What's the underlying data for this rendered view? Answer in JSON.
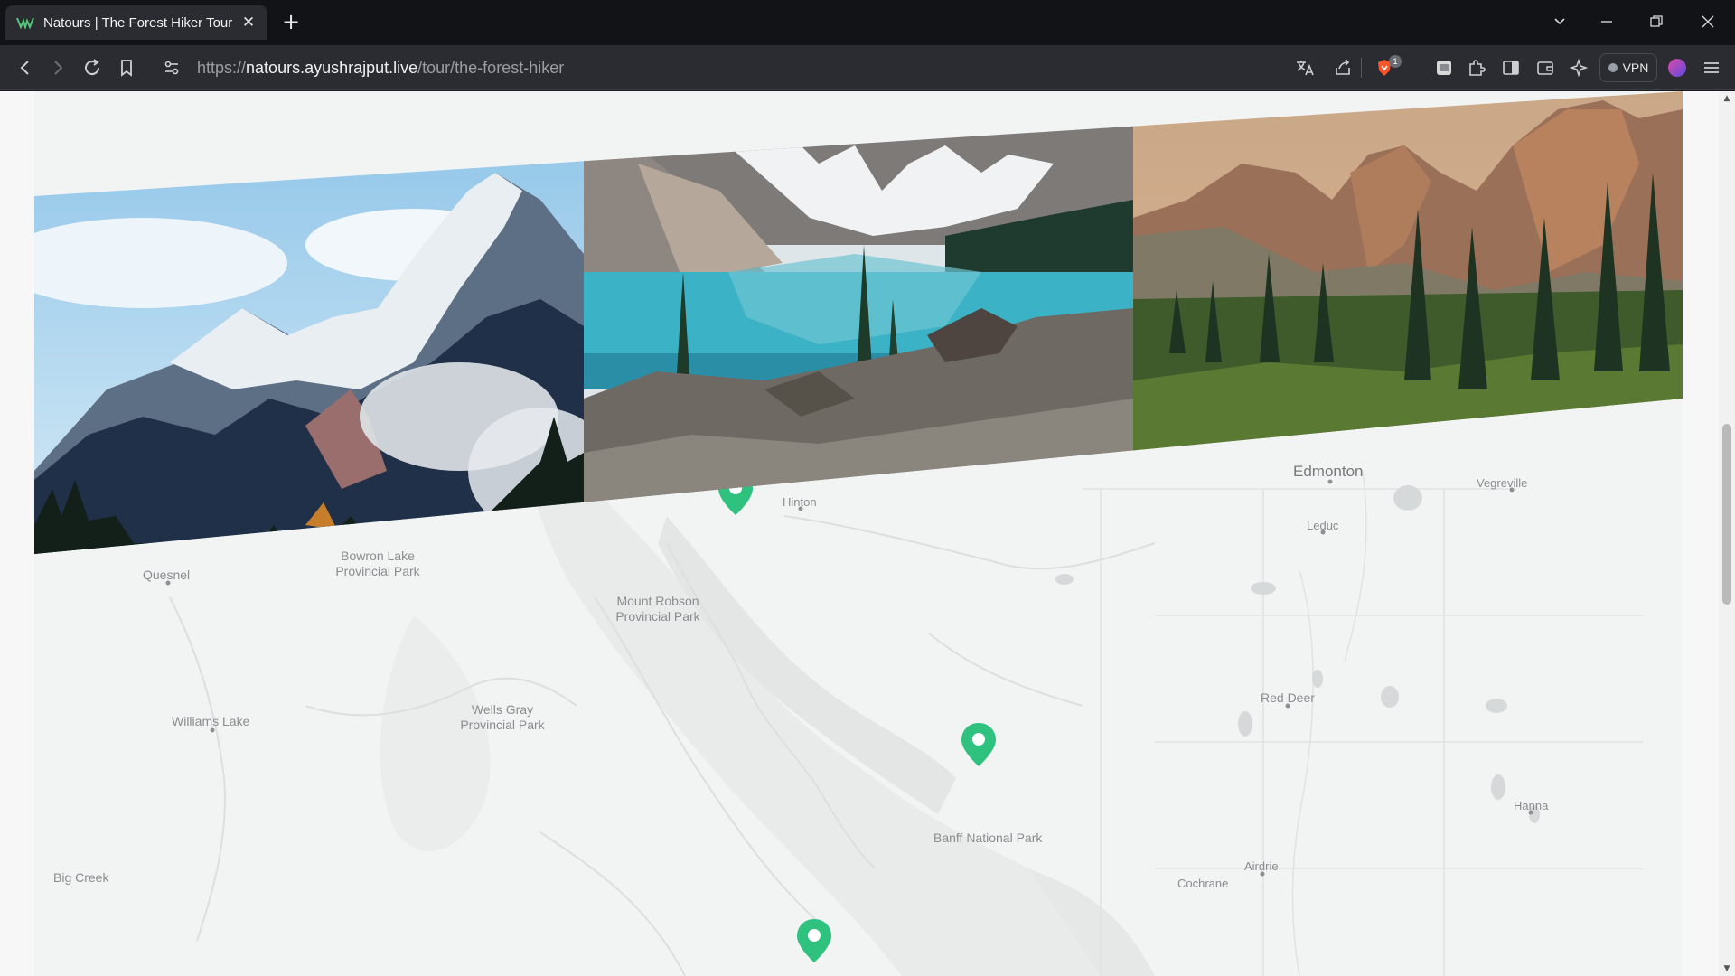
{
  "browser": {
    "tab_title": "Natours | The Forest Hiker Tour",
    "tab_close": "✕",
    "new_tab": "+",
    "url_prefix": "https://",
    "url_domain": "natours.ayushrajput.live",
    "url_path": "/tour/the-forest-hiker",
    "vpn_label": "VPN",
    "shield_badge": "1"
  },
  "map": {
    "labels": [
      {
        "text": "Edmonton",
        "kind": "city"
      },
      {
        "text": "Vegreville",
        "kind": "small"
      },
      {
        "text": "Hinton",
        "kind": "small"
      },
      {
        "text": "Leduc",
        "kind": "small"
      },
      {
        "text": "Quesnel",
        "kind": "normal"
      },
      {
        "text": "Bowron Lake\nProvincial Park",
        "kind": "normal"
      },
      {
        "text": "Mount Robson\nProvincial Park",
        "kind": "normal"
      },
      {
        "text": "Red Deer",
        "kind": "normal"
      },
      {
        "text": "Wells Gray\nProvincial Park",
        "kind": "normal"
      },
      {
        "text": "Williams Lake",
        "kind": "normal"
      },
      {
        "text": "Hanna",
        "kind": "small"
      },
      {
        "text": "Banff National Park",
        "kind": "normal"
      },
      {
        "text": "Airdrie",
        "kind": "small"
      },
      {
        "text": "Big Creek",
        "kind": "normal"
      },
      {
        "text": "Cochrane",
        "kind": "small"
      }
    ],
    "pin_color": "#2ec27e",
    "pin_count": 3
  },
  "colors": {
    "accent": "#28b487",
    "chrome_bg": "#2b2c31"
  }
}
